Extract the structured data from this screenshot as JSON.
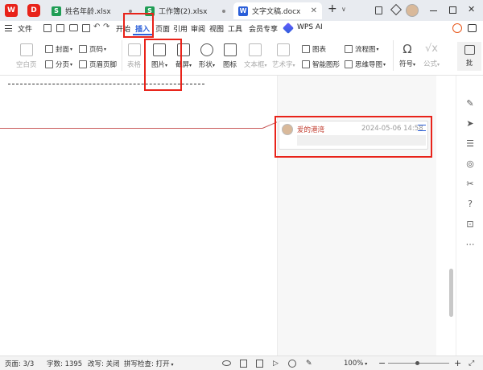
{
  "titlebar": {
    "tabs": [
      {
        "label": "姓名年龄.xlsx",
        "icon": "S",
        "color": "#1f9d55"
      },
      {
        "label": "工作簿(2).xlsx",
        "icon": "S",
        "color": "#1f9d55"
      },
      {
        "label": "文字文稿.docx",
        "icon": "W",
        "color": "#2b5fd9"
      }
    ],
    "new_tab": "+",
    "tab_menu": "∨"
  },
  "menubar": {
    "file": "文件",
    "items": [
      "开始",
      "插入",
      "页面",
      "引用",
      "审阅",
      "视图",
      "工具",
      "会员专享"
    ],
    "active": "插入",
    "wps_ai": "WPS AI"
  },
  "ribbon": {
    "blank_page": "空白页",
    "cover": "封面",
    "page_break": "分页",
    "page_number": "页码",
    "header_footer": "页眉页脚",
    "table": "表格",
    "picture": "图片",
    "screenshot": "截屏",
    "shape": "形状",
    "icon": "图标",
    "textbox": "文本框",
    "wordart": "艺术字",
    "chart": "图表",
    "smart_shape": "智能图形",
    "flowchart": "流程图",
    "mindmap": "思维导图",
    "symbol": "符号",
    "formula": "公式",
    "more": "批"
  },
  "comment": {
    "author": "爱的港湾",
    "timestamp": "2024-05-06 14:58"
  },
  "statusbar": {
    "page": "页面: 3/3",
    "words": "字数: 1395",
    "revise": "改写: 关闭",
    "spellcheck": "拼写检查: 打开",
    "zoom": "100%"
  },
  "colors": {
    "highlight": "#e8231a",
    "accent": "#2b5fd9"
  }
}
